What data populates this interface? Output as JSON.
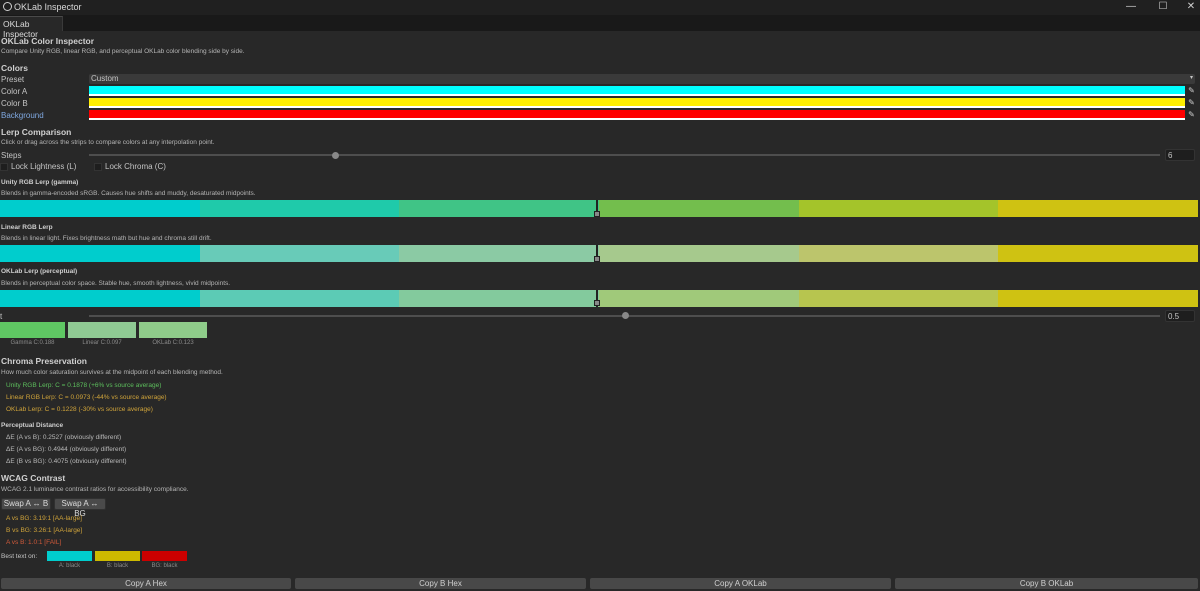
{
  "window": {
    "title": "OKLab Inspector",
    "minimize": "—",
    "maximize": "☐",
    "close": "✕"
  },
  "tab": {
    "label": "OKLab Inspector"
  },
  "header": {
    "title": "OKLab Color Inspector",
    "description": "Compare Unity RGB, linear RGB, and perceptual OKLab color blending side by side."
  },
  "colors": {
    "section": "Colors",
    "preset_label": "Preset",
    "preset_value": "Custom",
    "color_a_label": "Color A",
    "color_b_label": "Color B",
    "background_label": "Background",
    "color_a": "#00ffff",
    "color_b": "#ffee00",
    "background": "#ff0000"
  },
  "lerp": {
    "section": "Lerp Comparison",
    "description": "Click or drag across the strips to compare colors at any interpolation point.",
    "steps_label": "Steps",
    "steps_value": "6",
    "steps_fraction": 0.23,
    "lock_lightness": "Lock Lightness (L)",
    "lock_chroma": "Lock Chroma (C)",
    "t_label": "t",
    "t_value": "0.5",
    "t_fraction": 0.5,
    "strips": [
      {
        "title": "Unity RGB Lerp (gamma)",
        "description": "Blends in gamma-encoded sRGB. Causes hue shifts and muddy, desaturated midpoints.",
        "colors": [
          "#00cdcd",
          "#1fcaaa",
          "#40c486",
          "#73be4d",
          "#a4c42a",
          "#cfc212"
        ]
      },
      {
        "title": "Linear RGB Lerp",
        "description": "Blends in linear light. Fixes brightness math but hue and chroma still drift.",
        "colors": [
          "#00cdcd",
          "#68cbb8",
          "#8bcaa4",
          "#a6c98d",
          "#bcc56c",
          "#cfc212"
        ]
      },
      {
        "title": "OKLab Lerp (perceptual)",
        "description": "Blends in perceptual color space. Stable hue, smooth lightness, vivid midpoints.",
        "colors": [
          "#00cdcd",
          "#5ccbb5",
          "#83ca9d",
          "#a0c97a",
          "#b7c54f",
          "#cfc212"
        ]
      }
    ],
    "chips": [
      {
        "color": "#5fc763",
        "caption": "Gamma C:0.188"
      },
      {
        "color": "#8fca93",
        "caption": "Linear C:0.097"
      },
      {
        "color": "#8fcc8a",
        "caption": "OKLab C:0.123"
      }
    ]
  },
  "chroma": {
    "section": "Chroma Preservation",
    "description": "How much color saturation survives at the midpoint of each blending method.",
    "lines": [
      {
        "text": "Unity RGB Lerp: C = 0.1878   (+6% vs source average)",
        "color": "#5dbf5d"
      },
      {
        "text": "Linear RGB Lerp: C = 0.0973   (-44% vs source average)",
        "color": "#d0a43a"
      },
      {
        "text": "OKLab Lerp: C = 0.1228   (-30% vs source average)",
        "color": "#d0a43a"
      }
    ]
  },
  "distance": {
    "section": "Perceptual Distance",
    "lines": [
      "ΔE (A vs B):  0.2527  (obviously different)",
      "ΔE (A vs BG): 0.4944  (obviously different)",
      "ΔE (B vs BG): 0.4075  (obviously different)"
    ]
  },
  "wcag": {
    "section": "WCAG Contrast",
    "description": "WCAG 2.1 luminance contrast ratios for accessibility compliance.",
    "swap_ab": "Swap A ↔ B",
    "swap_abg": "Swap A ↔ BG",
    "lines": [
      {
        "text": "A vs BG: 3.19:1  [AA-large]",
        "color": "#d0a43a"
      },
      {
        "text": "B vs BG: 3.26:1  [AA-large]",
        "color": "#d0a43a"
      },
      {
        "text": "A vs B: 1.0:1  [FAIL]",
        "color": "#d05a3a"
      }
    ],
    "best_text_label": "Best text on:",
    "best": [
      {
        "color": "#00cdcd",
        "caption": "A: black"
      },
      {
        "color": "#cdba00",
        "caption": "B: black"
      },
      {
        "color": "#cc0000",
        "caption": "BG: black"
      }
    ]
  },
  "footer": {
    "copy_a_hex": "Copy A Hex",
    "copy_b_hex": "Copy B Hex",
    "copy_a_oklab": "Copy A OKLab",
    "copy_b_oklab": "Copy B OKLab"
  }
}
